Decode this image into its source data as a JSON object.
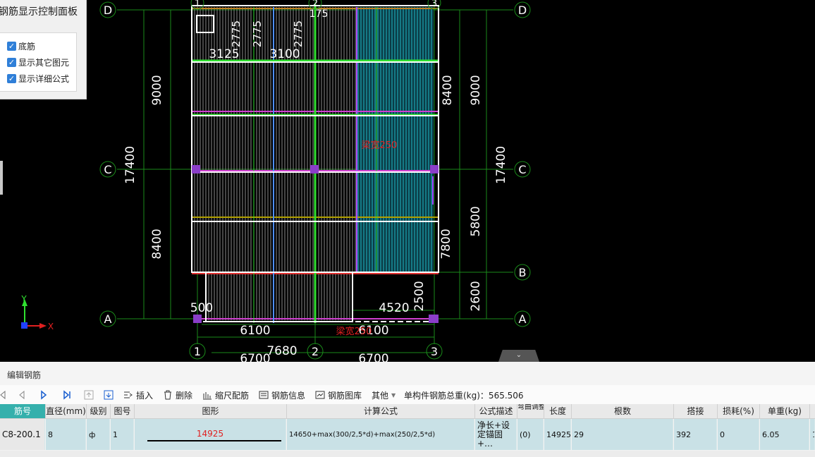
{
  "panel": {
    "title": "钢筋显示控制面板",
    "options": [
      {
        "label": "底筋",
        "checked": true
      },
      {
        "label": "显示其它图元",
        "checked": true
      },
      {
        "label": "显示详细公式",
        "checked": true
      }
    ]
  },
  "drawing": {
    "axes_letters": [
      "D",
      "C",
      "B",
      "A"
    ],
    "axes_numbers": [
      "1",
      "2",
      "3"
    ],
    "dims": {
      "left_9000": "9000",
      "left_8400": "8400",
      "left_17400": "17400",
      "right_8400": "8400",
      "right_9000": "9000",
      "right_17400": "17400",
      "right_5800": "5800",
      "right_7800": "7800",
      "right_2500": "2500",
      "right_2600": "2600",
      "top_3125": "3125",
      "top_3100": "3100",
      "top_2775a": "2775",
      "top_2775b": "2775",
      "top_2775c": "2775",
      "top_175": "175",
      "d_500": "500",
      "d_4520": "4520",
      "b_6100a": "6100",
      "b_6100b": "6100",
      "b_7680": "7680",
      "b_6700a": "6700",
      "b_6700b": "6700"
    },
    "labels": {
      "beam_width_1": "梁宽250",
      "beam_width_2": "梁宽250"
    },
    "axis_gizmo": {
      "y": "Y",
      "x": "X"
    }
  },
  "editor": {
    "title": "编辑钢筋",
    "toolbar": {
      "insert": "插入",
      "delete": "删除",
      "scale": "缩尺配筋",
      "info": "钢筋信息",
      "library": "钢筋图库",
      "other": "其他",
      "total_label": "单构件钢筋总重(kg)：565.506"
    },
    "columns": [
      "筋号",
      "直径(mm)",
      "级别",
      "图号",
      "图形",
      "计算公式",
      "公式描述",
      "弯曲调整",
      "长度",
      "根数",
      "搭接",
      "损耗(%)",
      "单重(kg)"
    ],
    "row": {
      "bar_no": "C8-200.1",
      "diameter": "8",
      "grade": "ф",
      "fig_no": "1",
      "shape_value": "14925",
      "formula": "14650+max(300/2,5*d)+max(250/2,5*d)",
      "desc": "净长+设定锚固+…",
      "bend": "(0)",
      "length": "14925",
      "count": "29",
      "lap": "392",
      "loss": "0",
      "unit_weight": "6.05",
      "extra": "1"
    }
  }
}
